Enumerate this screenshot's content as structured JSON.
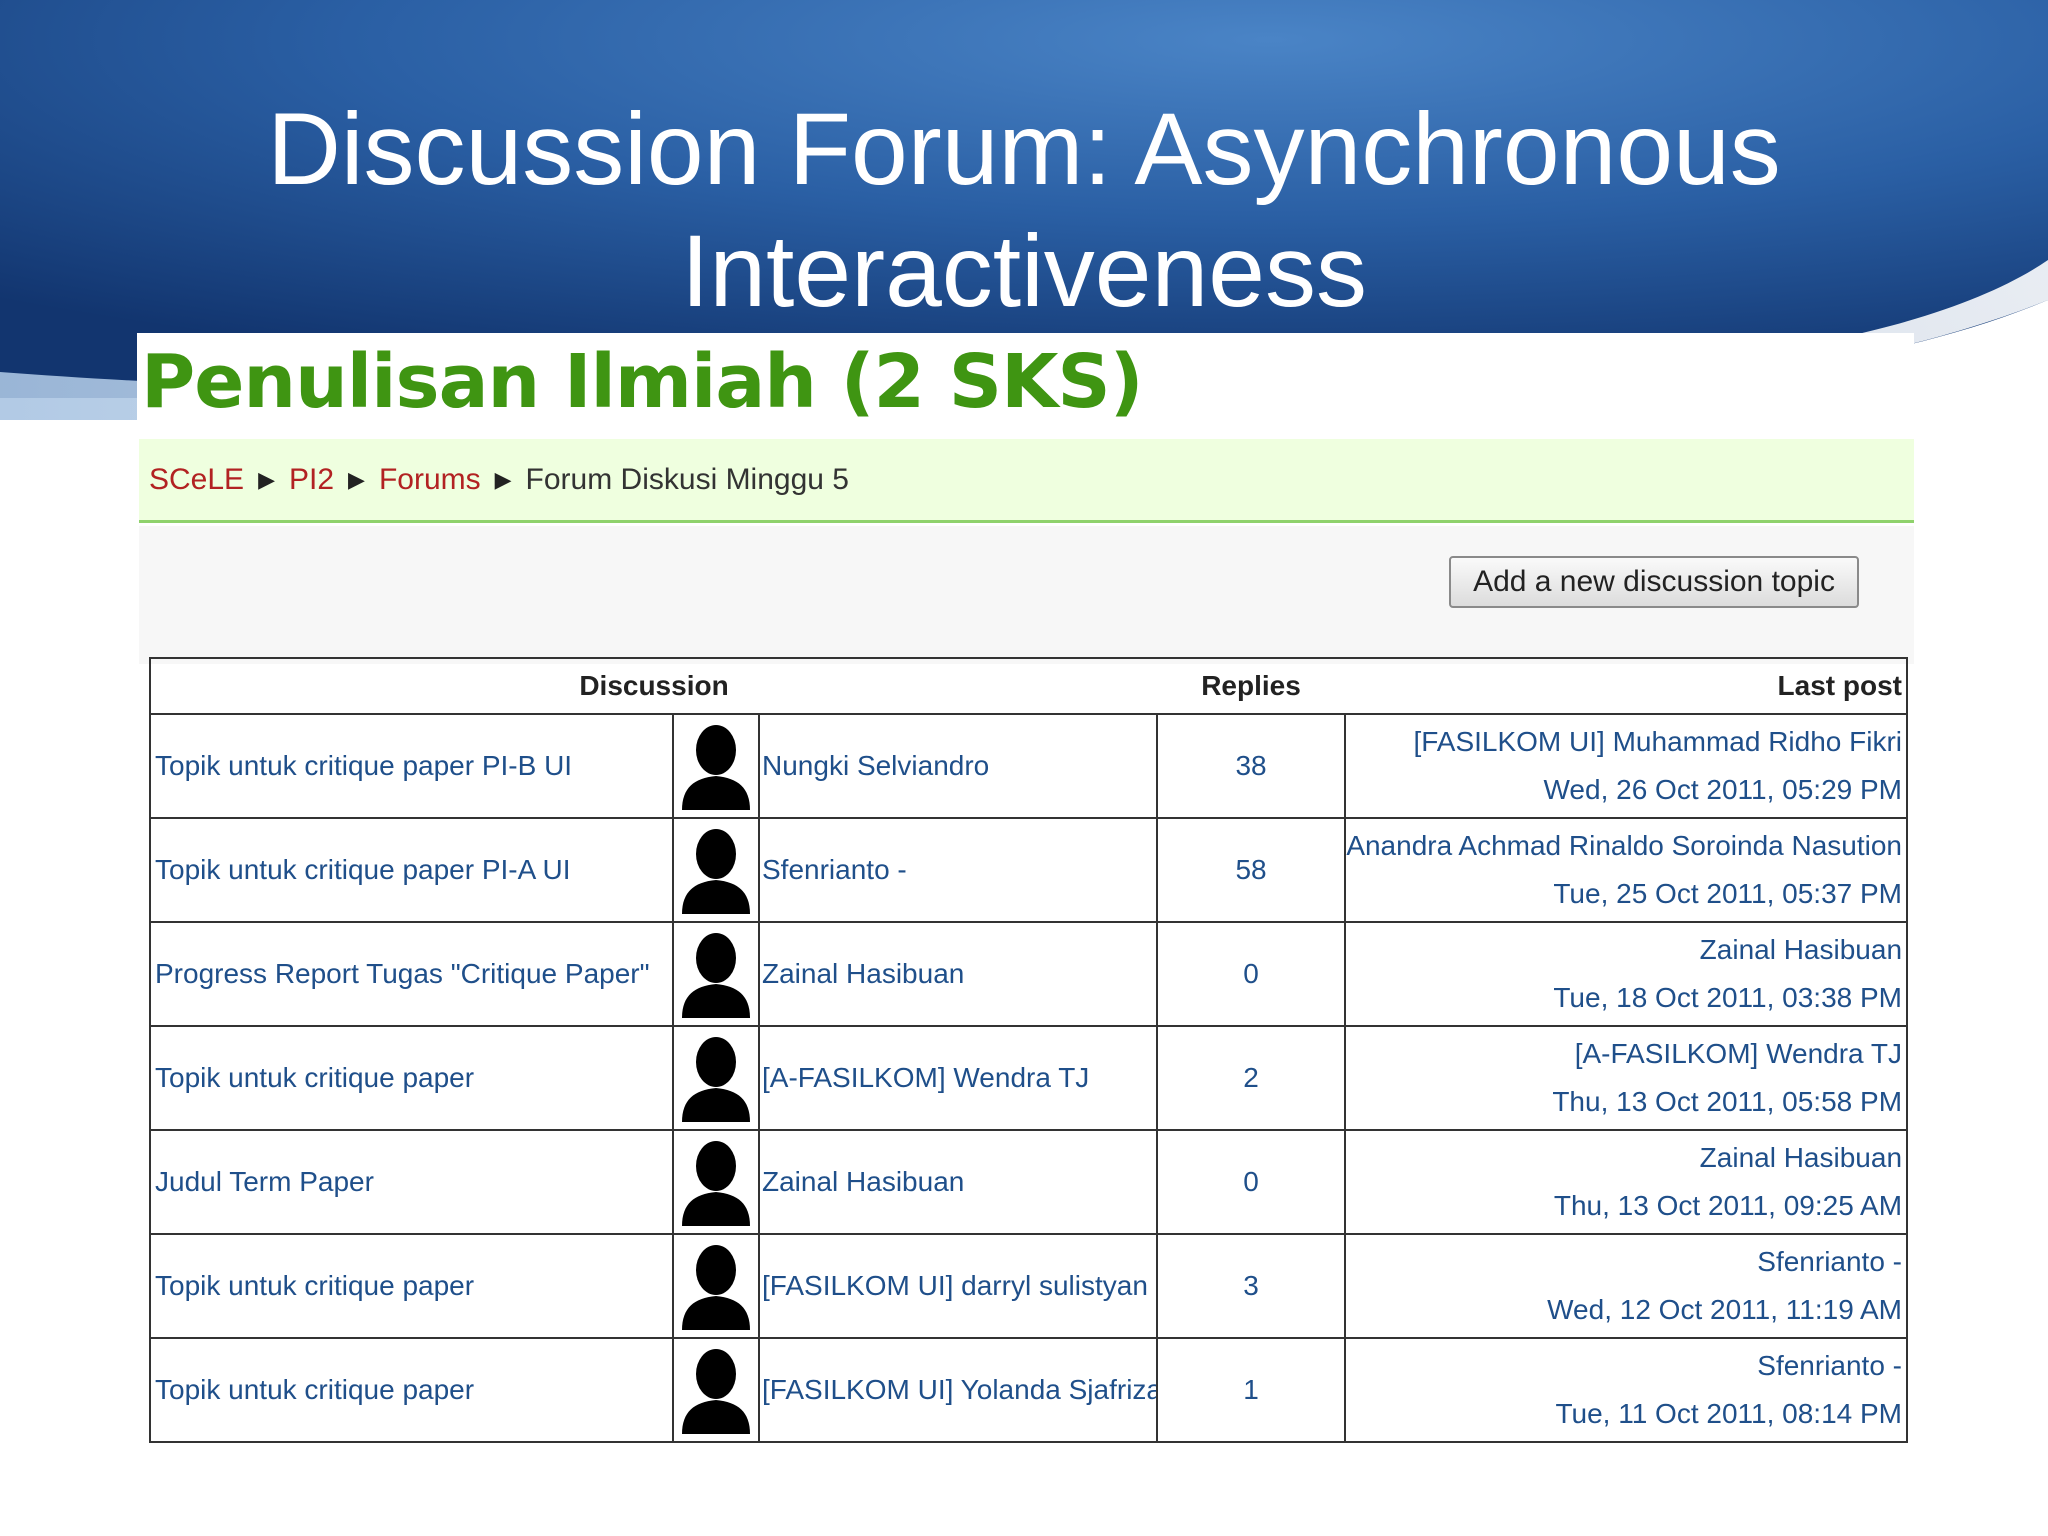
{
  "slide": {
    "title_line1": "Discussion Forum: Asynchronous",
    "title_line2": "Interactiveness"
  },
  "course": {
    "title": "Penulisan Ilmiah (2 SKS)"
  },
  "breadcrumb": {
    "items": [
      "SCeLE",
      "PI2",
      "Forums"
    ],
    "current": "Forum Diskusi Minggu 5",
    "separator": "▶"
  },
  "toolbar": {
    "add_topic_label": "Add a new discussion topic"
  },
  "table": {
    "headers": {
      "discussion": "Discussion",
      "replies": "Replies",
      "last_post": "Last post"
    },
    "rows": [
      {
        "topic": "Topik untuk critique paper PI-B UI",
        "author": "Nungki Selviandro",
        "replies": "38",
        "last_author": "[FASILKOM UI] Muhammad Ridho Fikri",
        "last_date": "Wed, 26 Oct 2011, 05:29 PM"
      },
      {
        "topic": "Topik untuk critique paper PI-A UI",
        "author": "Sfenrianto -",
        "replies": "58",
        "last_author": "Anandra Achmad Rinaldo Soroinda Nasution",
        "last_date": "Tue, 25 Oct 2011, 05:37 PM"
      },
      {
        "topic": "Progress Report Tugas \"Critique Paper\"",
        "author": "Zainal Hasibuan",
        "replies": "0",
        "last_author": "Zainal Hasibuan",
        "last_date": "Tue, 18 Oct 2011, 03:38 PM"
      },
      {
        "topic": "Topik untuk critique paper",
        "author": "[A-FASILKOM] Wendra TJ",
        "replies": "2",
        "last_author": "[A-FASILKOM] Wendra TJ",
        "last_date": "Thu, 13 Oct 2011, 05:58 PM"
      },
      {
        "topic": "Judul Term Paper",
        "author": "Zainal Hasibuan",
        "replies": "0",
        "last_author": "Zainal Hasibuan",
        "last_date": "Thu, 13 Oct 2011, 09:25 AM"
      },
      {
        "topic": "Topik untuk critique paper",
        "author": "[FASILKOM UI] darryl sulistyan",
        "replies": "3",
        "last_author": "Sfenrianto -",
        "last_date": "Wed, 12 Oct 2011, 11:19 AM"
      },
      {
        "topic": "Topik untuk critique paper",
        "author": "[FASILKOM UI] Yolanda Sjafrizal",
        "replies": "1",
        "last_author": "Sfenrianto -",
        "last_date": "Tue, 11 Oct 2011, 08:14 PM"
      }
    ]
  },
  "colors": {
    "slide_blue_dark": "#133a78",
    "slide_blue_light": "#3a73b7",
    "course_title_green": "#3f9512",
    "breadcrumb_bg": "#efffdf",
    "link_blue": "#1f4f8a",
    "breadcrumb_link_red": "#b22222"
  },
  "icons": {
    "avatar": "default-user-silhouette-icon"
  }
}
